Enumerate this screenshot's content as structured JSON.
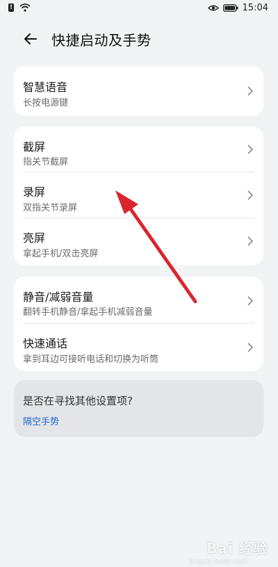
{
  "status": {
    "time": "15:04",
    "alert": "!",
    "icons": [
      "alert-icon",
      "wifi-icon",
      "eye-icon",
      "battery-icon"
    ]
  },
  "header": {
    "title": "快捷启动及手势",
    "back_icon": "back-arrow-icon"
  },
  "groups": [
    {
      "items": [
        {
          "title": "智慧语音",
          "subtitle": "长按电源键"
        }
      ]
    },
    {
      "items": [
        {
          "title": "截屏",
          "subtitle": "指关节截屏"
        },
        {
          "title": "录屏",
          "subtitle": "双指关节录屏"
        },
        {
          "title": "亮屏",
          "subtitle": "拿起手机/双击亮屏"
        }
      ]
    },
    {
      "items": [
        {
          "title": "静音/减弱音量",
          "subtitle": "翻转手机静音/拿起手机减弱音量"
        },
        {
          "title": "快速通话",
          "subtitle": "拿到耳边可接听电话和切换为听筒"
        }
      ]
    }
  ],
  "tip": {
    "question": "是否在寻找其他设置项?",
    "link": "隔空手势"
  },
  "watermark": {
    "text": "Bai 经验",
    "url": "jingyan.baidu.com"
  },
  "colors": {
    "background": "#f1f3f5",
    "card": "#ffffff",
    "link": "#1e64c8",
    "annotation_arrow": "#d9262c"
  }
}
